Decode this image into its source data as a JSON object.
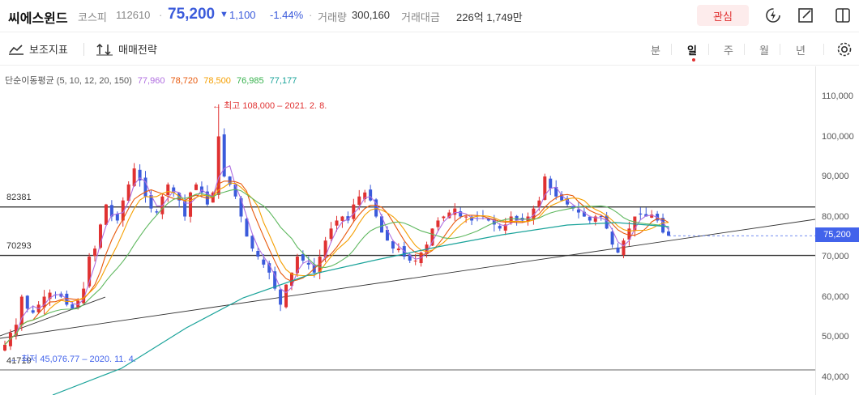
{
  "header": {
    "stock_name": "씨에스윈드",
    "market": "코스피",
    "code": "112610",
    "price": "75,200",
    "change": "1,100",
    "change_pct": "-1.44%",
    "volume_label": "거래량",
    "volume": "300,160",
    "amount_label": "거래대금",
    "amount": "226억 1,749만",
    "watch_label": "관심",
    "down_color": "#3b5bdb",
    "up_color": "#e03131"
  },
  "toolbar": {
    "indicator_label": "보조지표",
    "strategy_label": "매매전략",
    "periods": [
      "분",
      "일",
      "주",
      "월",
      "년"
    ],
    "active_period": "일"
  },
  "legend": {
    "title": "단순이동평균 (5, 10, 12, 20, 150)",
    "values": [
      {
        "value": "77,960",
        "color": "#b06ee0"
      },
      {
        "value": "78,720",
        "color": "#e8590c"
      },
      {
        "value": "78,500",
        "color": "#f59f00"
      },
      {
        "value": "76,985",
        "color": "#5fb85f"
      },
      {
        "value": "77,177",
        "color": "#1aa39a"
      }
    ]
  },
  "chart": {
    "y_ticks": [
      "110,000",
      "100,000",
      "90,000",
      "80,000",
      "70,000",
      "60,000",
      "50,000",
      "40,000"
    ],
    "current_price_tag": "75,200",
    "hline_labels": [
      "82381",
      "70293",
      "41719"
    ],
    "high_annotation": "최고 108,000 – 2021. 2. 8.",
    "low_annotation": "최저 45,076.77 – 2020. 11. 4."
  },
  "chart_data": {
    "type": "candlestick",
    "ylim": [
      39000,
      113000
    ],
    "y_ticks": [
      110000,
      100000,
      90000,
      80000,
      70000,
      60000,
      50000,
      40000
    ],
    "horizontal_lines": [
      82381,
      70293,
      41719
    ],
    "last_price": 75200,
    "high": {
      "value": 108000,
      "date": "2021. 2. 8."
    },
    "low": {
      "value": 45076.77,
      "date": "2020. 11. 4."
    },
    "closes": [
      48000,
      51000,
      53000,
      60000,
      57000,
      56000,
      58000,
      60000,
      61000,
      60500,
      60000,
      58000,
      57000,
      59000,
      62000,
      70000,
      72000,
      78000,
      83000,
      80000,
      79000,
      84000,
      88000,
      92000,
      89000,
      85000,
      82000,
      81000,
      85000,
      88000,
      86000,
      84000,
      80000,
      86000,
      88000,
      86000,
      83000,
      86000,
      100000,
      90000,
      88000,
      85000,
      80000,
      75000,
      72000,
      70000,
      68000,
      66000,
      62000,
      58000,
      63000,
      66000,
      70000,
      69000,
      68000,
      66000,
      70000,
      74000,
      77000,
      79000,
      80000,
      79000,
      83000,
      85000,
      86000,
      84000,
      80000,
      76000,
      74000,
      72000,
      72000,
      70000,
      69000,
      69000,
      71000,
      73000,
      77000,
      79000,
      80000,
      81000,
      82000,
      80000,
      80000,
      79000,
      79500,
      80000,
      79000,
      78000,
      77000,
      78000,
      80000,
      79000,
      79000,
      80000,
      82000,
      84000,
      90000,
      87000,
      85000,
      84000,
      83000,
      82000,
      81000,
      80000,
      79000,
      80000,
      80000,
      77000,
      73000,
      71000,
      74000,
      77000,
      80000,
      80500,
      80000,
      80500,
      79000,
      76000,
      75200
    ]
  }
}
